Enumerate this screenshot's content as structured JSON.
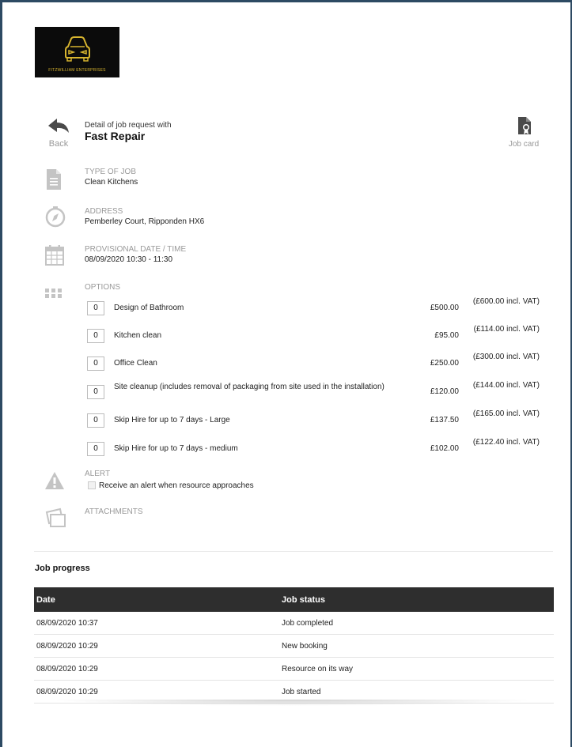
{
  "logo": {
    "text": "FITZWILLIAM ENTERPRISES"
  },
  "header": {
    "back_label": "Back",
    "title_small": "Detail of job request with",
    "title_big": "Fast Repair",
    "job_card_label": "Job card"
  },
  "sections": {
    "type_of_job": {
      "label": "TYPE OF JOB",
      "value": "Clean Kitchens"
    },
    "address": {
      "label": "ADDRESS",
      "value": "Pemberley Court, Ripponden HX6"
    },
    "provisional": {
      "label": "PROVISIONAL DATE / TIME",
      "value": "08/09/2020 10:30 - 11:30"
    },
    "options_label": "OPTIONS",
    "alert_label": "ALERT",
    "alert_checkbox": "Receive an alert when resource approaches",
    "attachments_label": "ATTACHMENTS"
  },
  "options": [
    {
      "qty": "0",
      "name": "Design of Bathroom",
      "price": "£500.00",
      "vat": "(£600.00 incl. VAT)"
    },
    {
      "qty": "0",
      "name": "Kitchen clean",
      "price": "£95.00",
      "vat": "(£114.00 incl. VAT)"
    },
    {
      "qty": "0",
      "name": "Office Clean",
      "price": "£250.00",
      "vat": "(£300.00 incl. VAT)"
    },
    {
      "qty": "0",
      "name": "Site cleanup (includes removal of packaging from site used in the installation)",
      "price": "£120.00",
      "vat": "(£144.00 incl. VAT)"
    },
    {
      "qty": "0",
      "name": "Skip Hire for up to 7 days - Large",
      "price": "£137.50",
      "vat": "(£165.00 incl. VAT)"
    },
    {
      "qty": "0",
      "name": "Skip Hire for up to 7 days - medium",
      "price": "£102.00",
      "vat": "(£122.40 incl. VAT)"
    }
  ],
  "progress": {
    "title": "Job progress",
    "headers": {
      "date": "Date",
      "status": "Job status"
    },
    "rows": [
      {
        "date": "08/09/2020 10:37",
        "status": "Job completed"
      },
      {
        "date": "08/09/2020 10:29",
        "status": "New booking"
      },
      {
        "date": "08/09/2020 10:29",
        "status": "Resource on its way"
      },
      {
        "date": "08/09/2020 10:29",
        "status": "Job started"
      }
    ]
  },
  "colors": {
    "frame": "#2d4a63",
    "icon_grey": "#bdbdbd",
    "header_dark": "#2e2e2e",
    "logo_gold": "#d8b52f"
  }
}
